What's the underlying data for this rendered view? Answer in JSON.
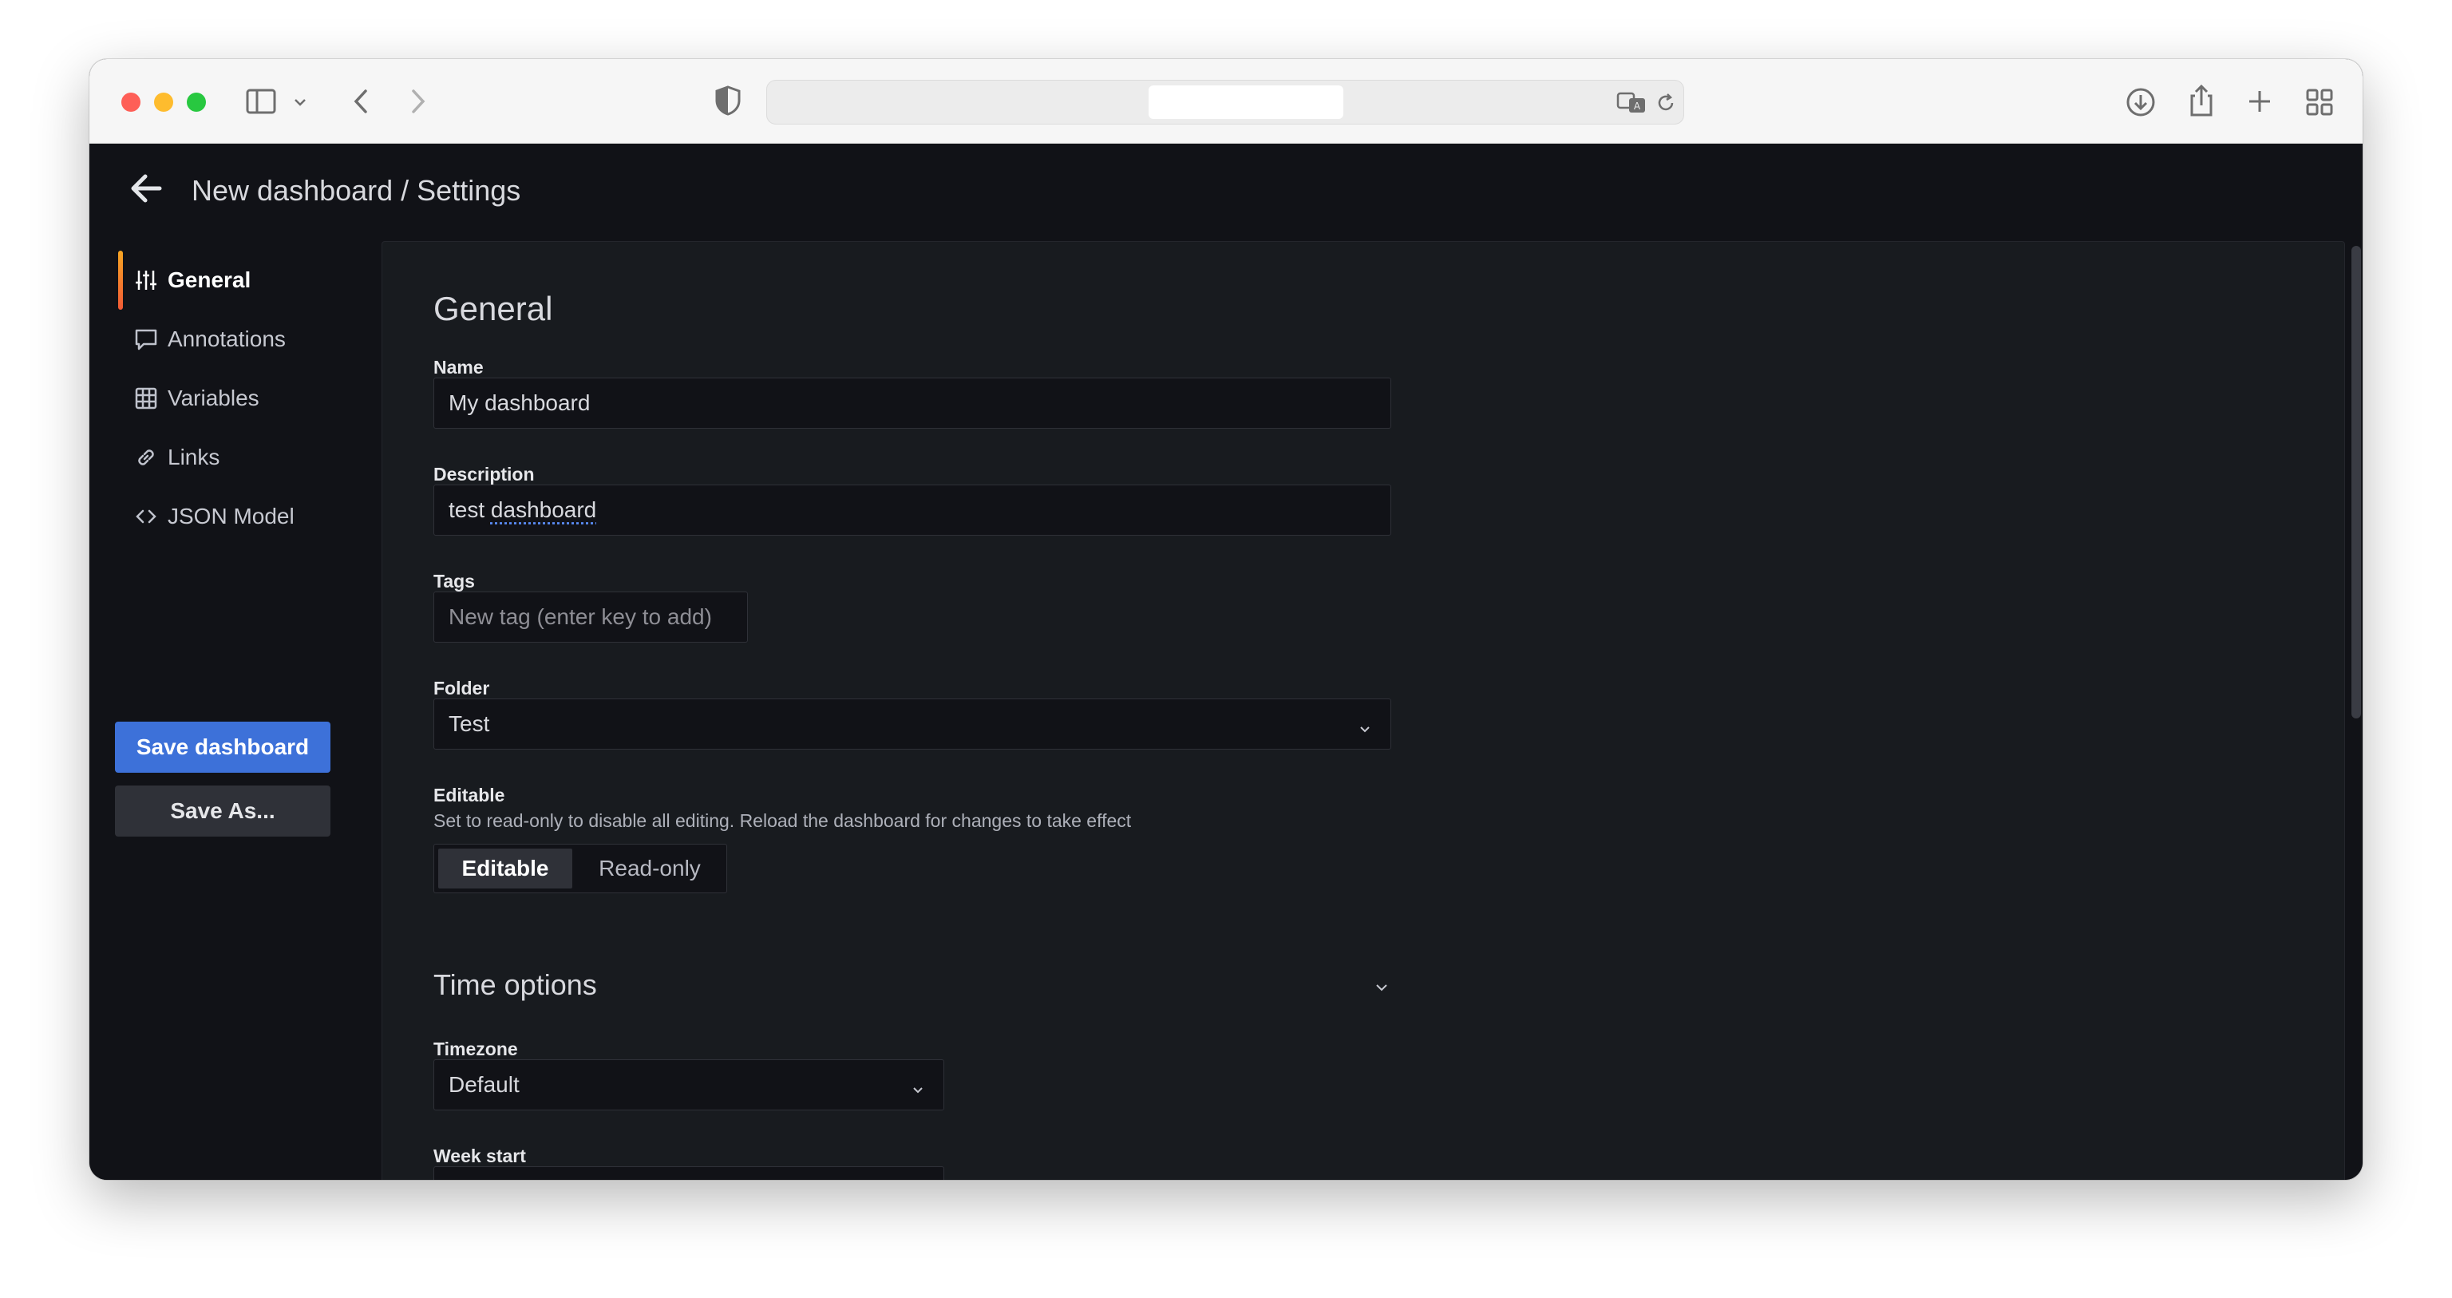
{
  "browser": {
    "address_text": "",
    "icons": [
      "sidebar-toggle-icon",
      "chevron-down-icon",
      "back-icon",
      "forward-icon",
      "shield-icon",
      "translate-icon",
      "reload-icon",
      "download-icon",
      "share-icon",
      "new-tab-icon",
      "tab-overview-icon"
    ]
  },
  "header": {
    "title": "New dashboard / Settings"
  },
  "sidebar": {
    "items": [
      {
        "label": "General",
        "icon": "sliders-icon",
        "active": true
      },
      {
        "label": "Annotations",
        "icon": "comment-icon",
        "active": false
      },
      {
        "label": "Variables",
        "icon": "grid-table-icon",
        "active": false
      },
      {
        "label": "Links",
        "icon": "link-icon",
        "active": false
      },
      {
        "label": "JSON Model",
        "icon": "code-icon",
        "active": false
      }
    ],
    "save_label": "Save dashboard",
    "save_as_label": "Save As..."
  },
  "general": {
    "heading": "General",
    "name_label": "Name",
    "name_value": "My dashboard",
    "description_label": "Description",
    "description_prefix": "test ",
    "description_underlined": "dashboard",
    "tags_label": "Tags",
    "tags_placeholder": "New tag (enter key to add)",
    "folder_label": "Folder",
    "folder_value": "Test",
    "editable_label": "Editable",
    "editable_hint": "Set to read-only to disable all editing. Reload the dashboard for changes to take effect",
    "editable_options": [
      "Editable",
      "Read-only"
    ],
    "editable_selected": "Editable"
  },
  "time_options": {
    "heading": "Time options",
    "timezone_label": "Timezone",
    "timezone_value": "Default",
    "week_start_label": "Week start"
  },
  "colors": {
    "primary": "#3d71d9",
    "active_indicator_top": "#f7a623",
    "active_indicator_bottom": "#f25a36",
    "background": "#111217",
    "panel": "#181b1f"
  }
}
